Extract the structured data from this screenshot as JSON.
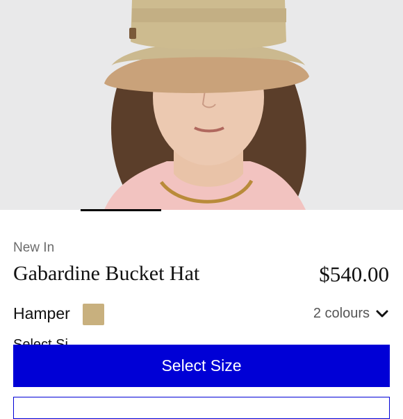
{
  "product": {
    "eyebrow": "New In",
    "name": "Gabardine Bucket Hat",
    "price": "$540.00",
    "colour_name": "Hamper",
    "swatch_color": "#c8b07e",
    "colours_count": "2 colours",
    "size_label_partial": "Select Si"
  },
  "actions": {
    "primary_label": "Select Size"
  },
  "icons": {
    "colours_toggle": "chevron-down-icon"
  },
  "colors": {
    "accent": "#0000d6",
    "hero_background": "#e9e9ea"
  }
}
